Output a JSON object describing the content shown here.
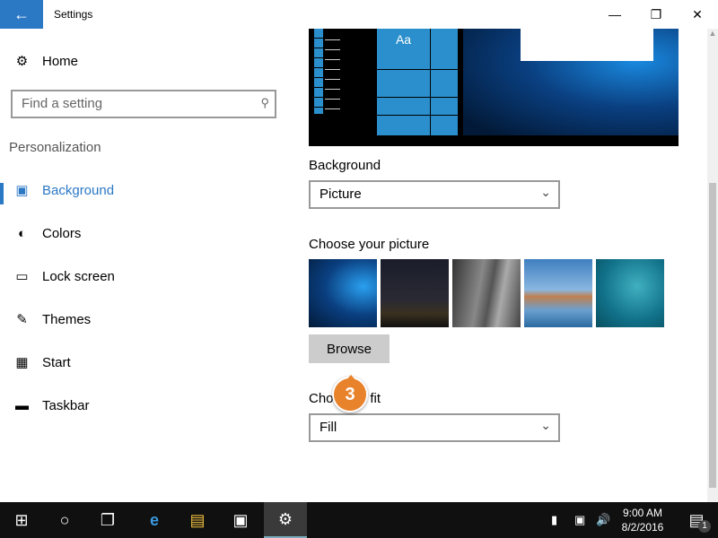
{
  "window": {
    "title": "Settings",
    "back_icon": "arrow-left-icon"
  },
  "sidebar": {
    "home": "Home",
    "search_placeholder": "Find a setting",
    "section": "Personalization",
    "items": [
      {
        "label": "Background",
        "icon": "picture-icon",
        "selected": true
      },
      {
        "label": "Colors",
        "icon": "palette-icon"
      },
      {
        "label": "Lock screen",
        "icon": "lock-screen-icon"
      },
      {
        "label": "Themes",
        "icon": "themes-icon"
      },
      {
        "label": "Start",
        "icon": "start-icon"
      },
      {
        "label": "Taskbar",
        "icon": "taskbar-icon"
      }
    ]
  },
  "main": {
    "preview_tile_text": "Aa",
    "background_label": "Background",
    "background_value": "Picture",
    "choose_picture_label": "Choose your picture",
    "browse_label": "Browse",
    "choose_fit_label": "Choose a fit",
    "fit_value": "Fill"
  },
  "callout": {
    "number": "3",
    "color": "#e8822b"
  },
  "accent": "#2b78c5",
  "taskbar": {
    "time": "9:00 AM",
    "date": "8/2/2016",
    "notifications": "1"
  }
}
